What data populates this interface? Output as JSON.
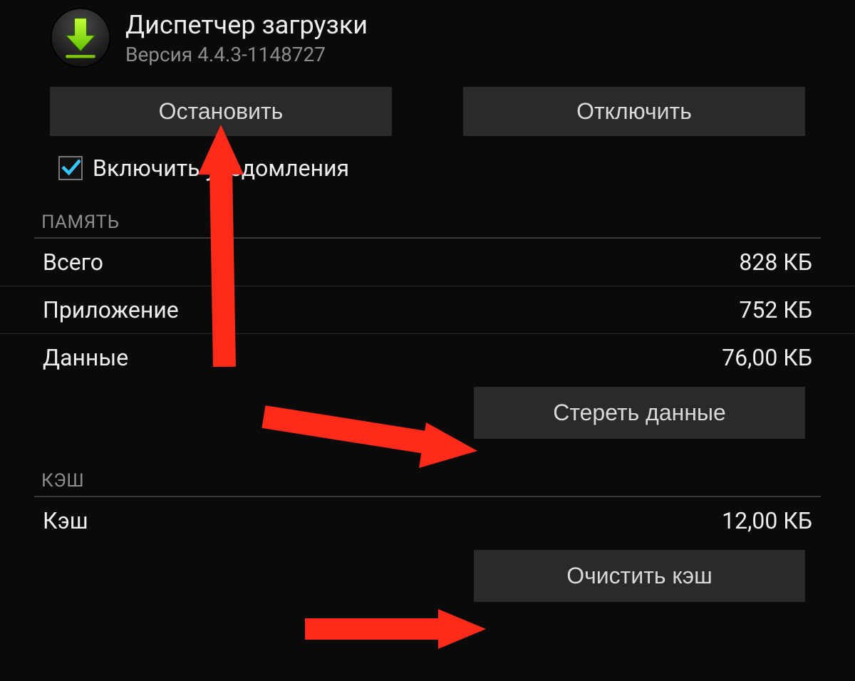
{
  "header": {
    "app_name": "Диспетчер загрузки",
    "version": "Версия 4.4.3-1148727"
  },
  "buttons": {
    "stop": "Остановить",
    "disable": "Отключить"
  },
  "checkbox": {
    "notifications_label": "Включить уведомления",
    "notifications_checked": true
  },
  "sections": {
    "memory": {
      "title": "ПАМЯТЬ",
      "rows": {
        "total_label": "Всего",
        "total_value": "828 КБ",
        "app_label": "Приложение",
        "app_value": "752 КБ",
        "data_label": "Данные",
        "data_value": "76,00 КБ"
      },
      "clear_data_button": "Стереть данные"
    },
    "cache": {
      "title": "КЭШ",
      "rows": {
        "cache_label": "Кэш",
        "cache_value": "12,00 КБ"
      },
      "clear_cache_button": "Очистить кэш"
    }
  }
}
